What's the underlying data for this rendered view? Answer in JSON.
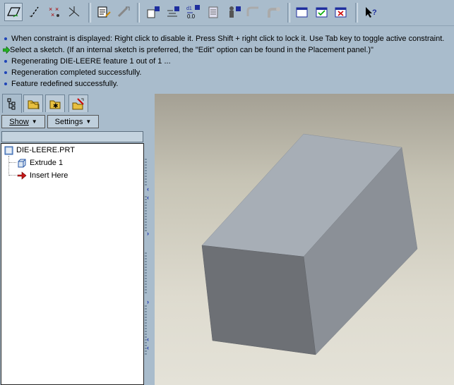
{
  "messages": [
    {
      "icon": "info-bullet-icon",
      "text": "When constraint is displayed: Right click to disable it. Press Shift + right click to lock it. Use Tab key to toggle active constraint."
    },
    {
      "icon": "green-arrow-icon",
      "text": "Select a sketch. (If an internal sketch is preferred, the \"Edit\" option can be found in the Placement panel.)\""
    },
    {
      "icon": "info-bullet-icon",
      "text": "Regenerating DIE-LEERE feature 1 out of 1 ..."
    },
    {
      "icon": "info-bullet-icon",
      "text": "Regeneration completed successfully."
    },
    {
      "icon": "info-bullet-icon",
      "text": "Feature redefined successfully."
    }
  ],
  "panel": {
    "show_label": "Show",
    "settings_label": "Settings"
  },
  "tree": {
    "root": "DIE-LEERE.PRT",
    "items": [
      "Extrude 1",
      "Insert Here"
    ]
  },
  "toolbar": {
    "regen_value": "0.0"
  },
  "colors": {
    "background": "#a9bccc",
    "viewport_top": "#a4a094",
    "viewport_bottom": "#e4e2d8",
    "box_top": "#a4acb5",
    "box_front": "#6b6e73",
    "box_side": "#8a8f96"
  }
}
